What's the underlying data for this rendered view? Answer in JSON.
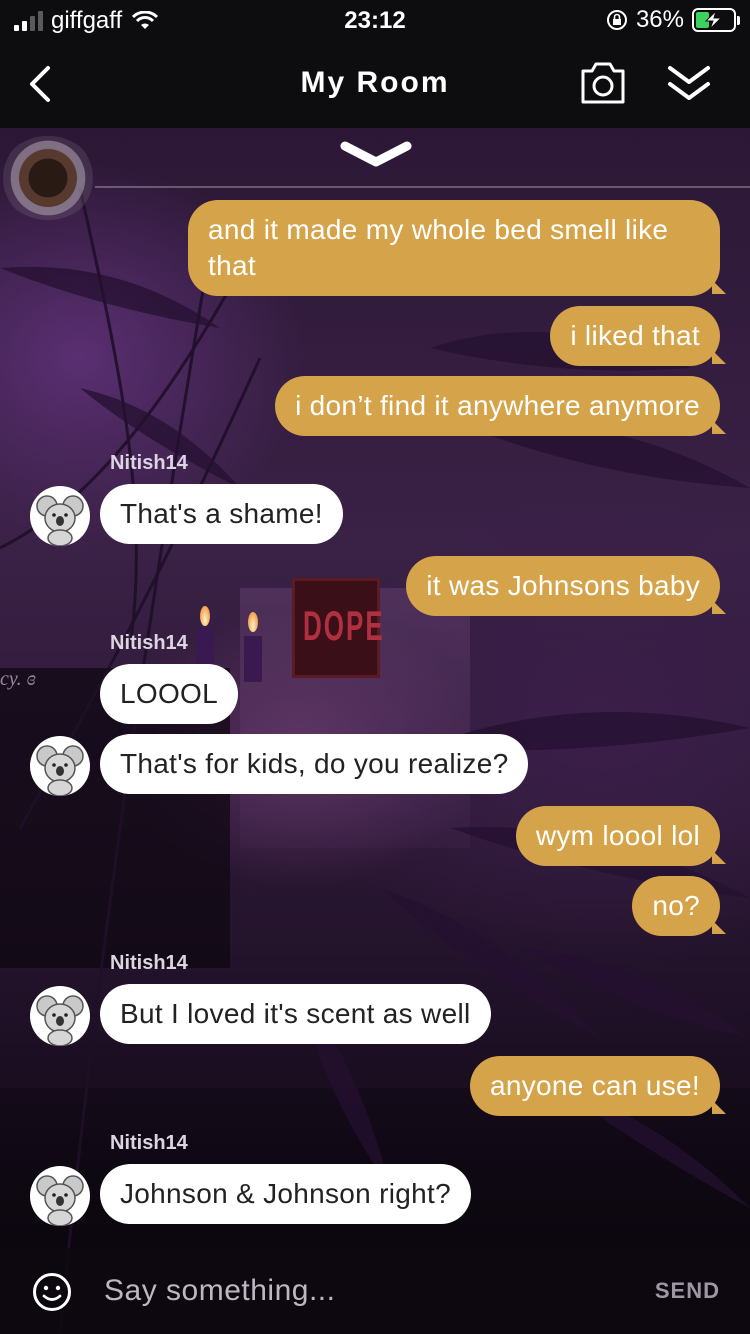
{
  "status_bar": {
    "carrier": "giffgaff",
    "time": "23:12",
    "battery_percent": "36%",
    "battery_level": 0.36,
    "icons": [
      "signal-icon",
      "wifi-icon",
      "orientation-lock-icon",
      "battery-charging-icon"
    ]
  },
  "header": {
    "title": "My Room",
    "icons": [
      "back-chevron-icon",
      "camera-icon",
      "double-chevron-down-icon"
    ]
  },
  "scene": {
    "poster_text": "DOPE",
    "side_text": "cy. ɞ"
  },
  "messages": [
    {
      "from": "me",
      "text": "and it made my whole bed smell like that"
    },
    {
      "from": "me",
      "text": "i liked that"
    },
    {
      "from": "me",
      "text": "i don’t find it anywhere anymore"
    },
    {
      "from": "Nitish14",
      "sender_label": "Nitish14",
      "text": "That's a shame!"
    },
    {
      "from": "me",
      "text": "it was Johnsons baby"
    },
    {
      "from": "Nitish14",
      "sender_label": "Nitish14",
      "text": "LOOOL"
    },
    {
      "from": "Nitish14",
      "text": "That's for kids, do you realize?"
    },
    {
      "from": "me",
      "text": "wym loool lol"
    },
    {
      "from": "me",
      "text": "no?"
    },
    {
      "from": "Nitish14",
      "sender_label": "Nitish14",
      "text": "But I loved it's scent as well"
    },
    {
      "from": "me",
      "text": "anyone can use!"
    },
    {
      "from": "Nitish14",
      "sender_label": "Nitish14",
      "text": "Johnson & Johnson right?"
    }
  ],
  "composer": {
    "placeholder": "Say something...",
    "send_label": "SEND"
  },
  "colors": {
    "my_bubble": "#d5a34a",
    "their_bubble": "#ffffff",
    "header_bg": "#0d0d0f",
    "charging": "#3bd25d"
  }
}
